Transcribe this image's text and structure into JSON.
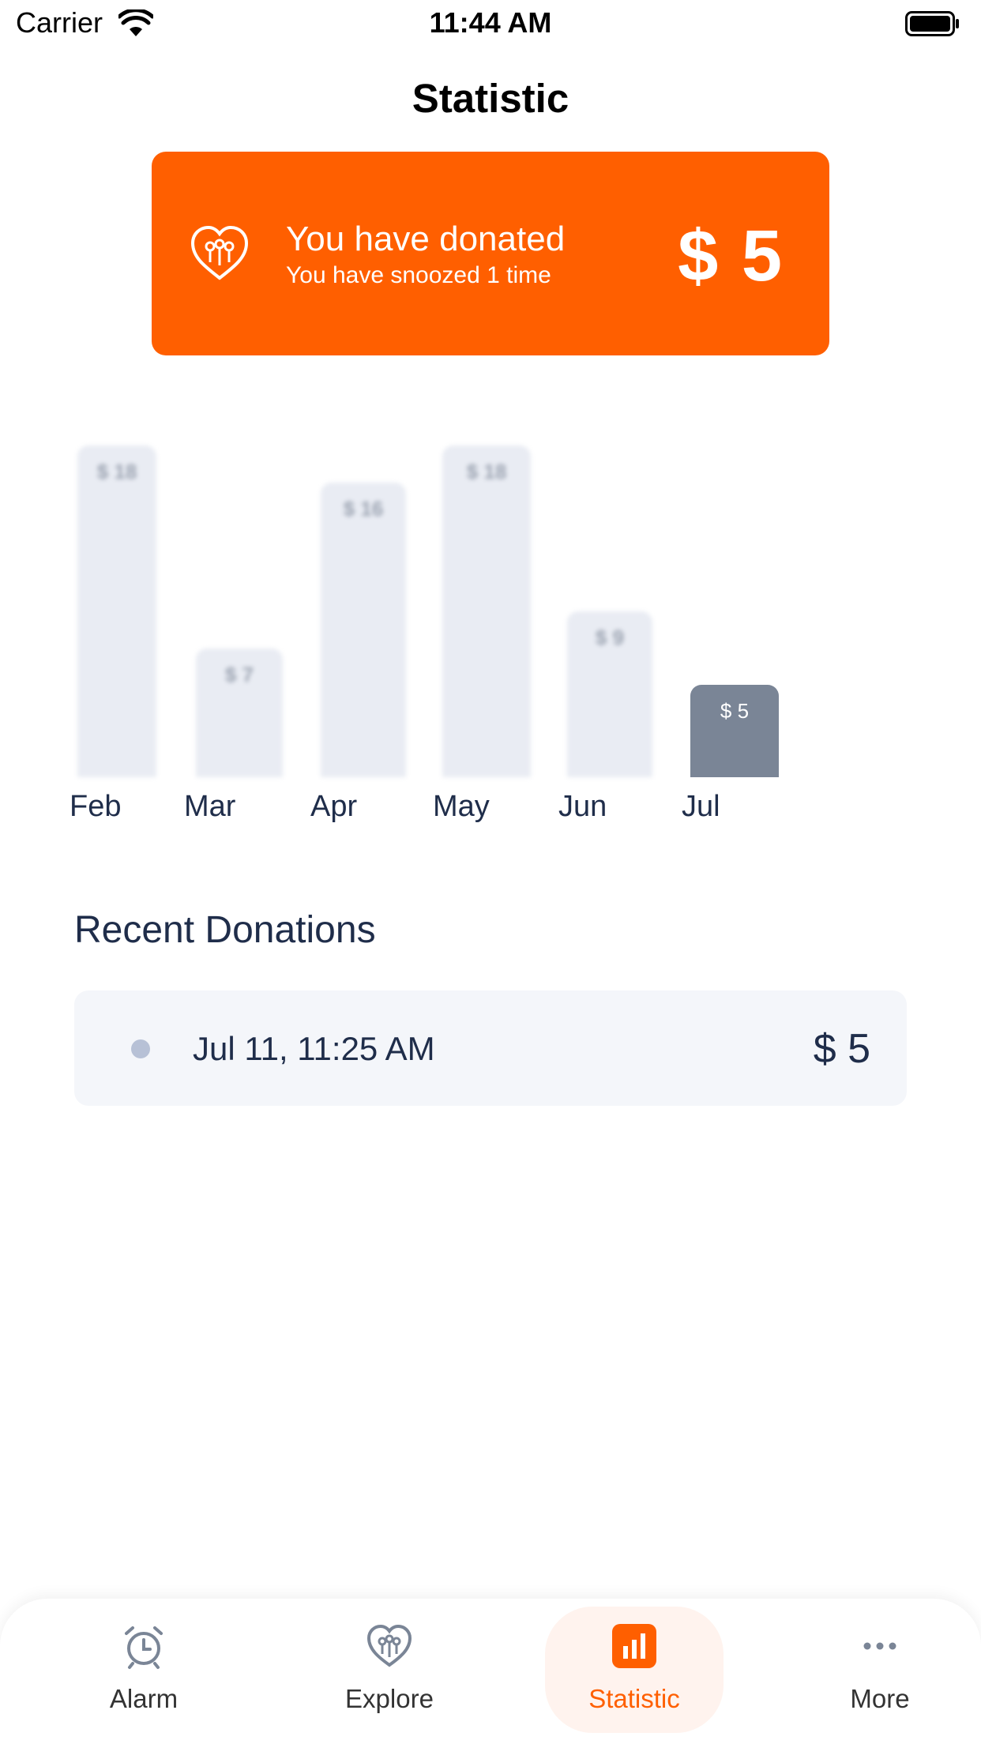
{
  "status_bar": {
    "carrier": "Carrier",
    "time": "11:44 AM"
  },
  "nav": {
    "title": "Statistic"
  },
  "donation_card": {
    "title": "You have donated",
    "subtitle": "You have snoozed 1 time",
    "amount": "$ 5",
    "background": "#ff5f00"
  },
  "chart_data": {
    "type": "bar",
    "categories": [
      "Feb",
      "Mar",
      "Apr",
      "May",
      "Jun",
      "Jul"
    ],
    "values": [
      18,
      7,
      16,
      18,
      9,
      5
    ],
    "labels": [
      "$ 18",
      "$ 7",
      "$ 16",
      "$ 18",
      "$ 9",
      "$ 5"
    ],
    "highlighted": "Jul",
    "colors": {
      "bar": "#e9ecf3",
      "highlight": "#7a8596"
    },
    "title": "",
    "xlabel": "",
    "ylabel": "",
    "ylim": [
      0,
      18
    ],
    "grid": false
  },
  "recent": {
    "title": "Recent Donations",
    "items": [
      {
        "date": "Jul 11, 11:25 AM",
        "amount": "$ 5"
      }
    ]
  },
  "tabs": [
    {
      "label": "Alarm",
      "icon": "alarm-clock-icon",
      "selected": false
    },
    {
      "label": "Explore",
      "icon": "heart-people-icon",
      "selected": false
    },
    {
      "label": "Statistic",
      "icon": "bar-chart-icon",
      "selected": true
    },
    {
      "label": "More",
      "icon": "more-dots-icon",
      "selected": false
    }
  ],
  "colors": {
    "accent": "#ff5f00",
    "text_dark": "#1f2d4a"
  }
}
